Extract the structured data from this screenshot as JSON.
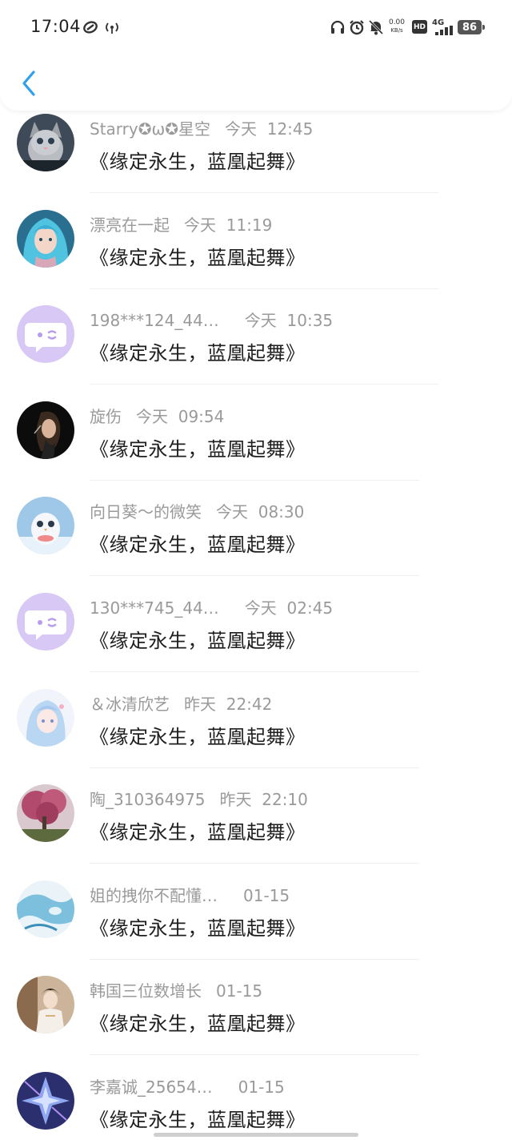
{
  "status_bar": {
    "time": "17:04",
    "net_speed_value": "0.00",
    "net_speed_unit": "KB/s",
    "hd_label": "HD",
    "network_type": "4G",
    "battery_level": "86"
  },
  "header": {
    "back_icon": "chevron-left-icon",
    "accent_color": "#2ea0ee"
  },
  "comments": [
    {
      "name": "Starry✪ω✪星空",
      "time": "今天  12:45",
      "message": "《缘定永生，蓝凰起舞》",
      "avatar": "kitten"
    },
    {
      "name": "漂亮在一起",
      "time": "今天  11:19",
      "message": "《缘定永生，蓝凰起舞》",
      "avatar": "blue-hair-girl"
    },
    {
      "name": "198***124_44…",
      "time": "今天  10:35",
      "message": "《缘定永生，蓝凰起舞》",
      "avatar": "default-chat"
    },
    {
      "name": "旋伤",
      "time": "今天  09:54",
      "message": "《缘定永生，蓝凰起舞》",
      "avatar": "dark-portrait"
    },
    {
      "name": "向日葵～的微笑",
      "time": "今天  08:30",
      "message": "《缘定永生，蓝凰起舞》",
      "avatar": "snow-owl"
    },
    {
      "name": "130***745_44…",
      "time": "今天  02:45",
      "message": "《缘定永生，蓝凰起舞》",
      "avatar": "default-chat"
    },
    {
      "name": "＆冰清欣艺",
      "time": "昨天  22:42",
      "message": "《缘定永生，蓝凰起舞》",
      "avatar": "anime-girl"
    },
    {
      "name": "陶_310364975",
      "time": "昨天  22:10",
      "message": "《缘定永生，蓝凰起舞》",
      "avatar": "cherry-tree"
    },
    {
      "name": "姐的拽你不配懂…",
      "time": "01-15",
      "message": "《缘定永生，蓝凰起舞》",
      "avatar": "watercolor"
    },
    {
      "name": "韩国三位数增长",
      "time": "01-15",
      "message": "《缘定永生，蓝凰起舞》",
      "avatar": "costume-girl"
    },
    {
      "name": "李嘉诚_25654…",
      "time": "01-15",
      "message": "《缘定永生，蓝凰起舞》",
      "avatar": "crystal"
    }
  ]
}
